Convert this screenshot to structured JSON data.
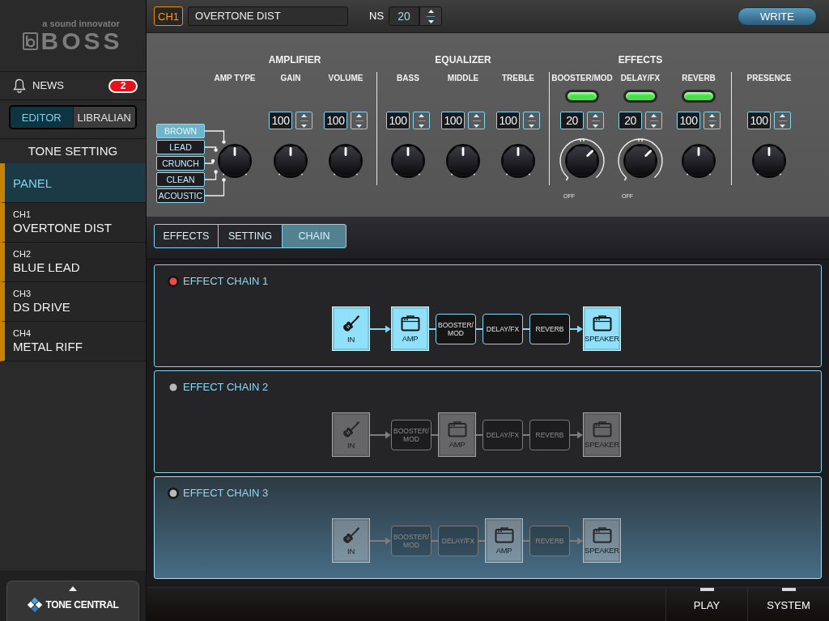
{
  "sidebar": {
    "brand": {
      "tagline": "a sound innovator",
      "name": "BOSS"
    },
    "news": {
      "label": "NEWS",
      "count": "2"
    },
    "mode_tabs": [
      {
        "label": "EDITOR",
        "selected": true
      },
      {
        "label": "LIBRALIAN",
        "selected": false
      }
    ],
    "tone_setting": {
      "title": "TONE SETTING",
      "items": [
        {
          "name": "PANEL",
          "selected": true
        },
        {
          "channel": "CH1",
          "name": "OVERTONE DIST",
          "selected": false
        },
        {
          "channel": "CH2",
          "name": "BLUE LEAD",
          "selected": false
        },
        {
          "channel": "CH3",
          "name": "DS DRIVE",
          "selected": false
        },
        {
          "channel": "CH4",
          "name": "METAL RIFF",
          "selected": false
        }
      ]
    },
    "tone_central": {
      "label": "TONE CENTRAL"
    }
  },
  "header": {
    "channel": "CH1",
    "patch_name": "OVERTONE DIST",
    "ns": {
      "label": "NS",
      "value": "20"
    },
    "write_button": "WRITE"
  },
  "amp_panel": {
    "groups": [
      {
        "title": "AMPLIFIER",
        "controls": [
          {
            "kind": "selector",
            "label": "AMP TYPE",
            "level": 0.5,
            "options": [
              {
                "label": "BROWN",
                "selected": true
              },
              {
                "label": "LEAD",
                "selected": false
              },
              {
                "label": "CRUNCH",
                "selected": false
              },
              {
                "label": "CLEAN",
                "selected": false
              },
              {
                "label": "ACOUSTIC",
                "selected": false
              }
            ]
          },
          {
            "kind": "knob",
            "label": "GAIN",
            "value": "100",
            "level": 0.5
          },
          {
            "kind": "knob",
            "label": "VOLUME",
            "value": "100",
            "level": 0.5
          }
        ]
      },
      {
        "title": "EQUALIZER",
        "controls": [
          {
            "kind": "knob",
            "label": "BASS",
            "value": "100",
            "level": 0.5
          },
          {
            "kind": "knob",
            "label": "MIDDLE",
            "value": "100",
            "level": 0.5
          },
          {
            "kind": "knob",
            "label": "TREBLE",
            "value": "100",
            "level": 0.5
          }
        ]
      },
      {
        "title": "EFFECTS",
        "controls": [
          {
            "kind": "effect_knob",
            "label": "BOOSTER/MOD",
            "on": true,
            "value": "20",
            "level": 0.67,
            "off_label": "OFF"
          },
          {
            "kind": "effect_knob",
            "label": "DELAY/FX",
            "on": true,
            "value": "20",
            "level": 0.67,
            "off_label": "OFF"
          },
          {
            "kind": "effect_knob",
            "label": "REVERB",
            "on": true,
            "value": "100",
            "level": 0.5
          }
        ]
      },
      {
        "controls": [
          {
            "kind": "knob",
            "label": "PRESENCE",
            "value": "100",
            "level": 0.5
          }
        ]
      }
    ]
  },
  "tabs": [
    {
      "label": "EFFECTS",
      "selected": false
    },
    {
      "label": "SETTING",
      "selected": false
    },
    {
      "label": "CHAIN",
      "selected": true
    }
  ],
  "effect_chains": [
    {
      "title": "EFFECT CHAIN 1",
      "active": true,
      "selected": false,
      "blocks": [
        {
          "kind": "input",
          "label": "IN"
        },
        {
          "kind": "amp",
          "label": "AMP"
        },
        {
          "kind": "effect",
          "label": "BOOSTER/MOD"
        },
        {
          "kind": "effect",
          "label": "DELAY/FX"
        },
        {
          "kind": "effect",
          "label": "REVERB"
        },
        {
          "kind": "speaker",
          "label": "SPEAKER"
        }
      ]
    },
    {
      "title": "EFFECT CHAIN 2",
      "active": false,
      "selected": false,
      "blocks": [
        {
          "kind": "input",
          "label": "IN"
        },
        {
          "kind": "effect",
          "label": "BOOSTER/MOD"
        },
        {
          "kind": "amp",
          "label": "AMP"
        },
        {
          "kind": "effect",
          "label": "DELAY/FX"
        },
        {
          "kind": "effect",
          "label": "REVERB"
        },
        {
          "kind": "speaker",
          "label": "SPEAKER"
        }
      ]
    },
    {
      "title": "EFFECT CHAIN 3",
      "active": false,
      "selected": true,
      "blocks": [
        {
          "kind": "input",
          "label": "IN"
        },
        {
          "kind": "effect",
          "label": "BOOSTER/MOD"
        },
        {
          "kind": "effect",
          "label": "DELAY/FX"
        },
        {
          "kind": "amp",
          "label": "AMP"
        },
        {
          "kind": "effect",
          "label": "REVERB"
        },
        {
          "kind": "speaker",
          "label": "SPEAKER"
        }
      ]
    }
  ],
  "bottom_nav": [
    {
      "label": "PLAY"
    },
    {
      "label": "SYSTEM"
    }
  ]
}
